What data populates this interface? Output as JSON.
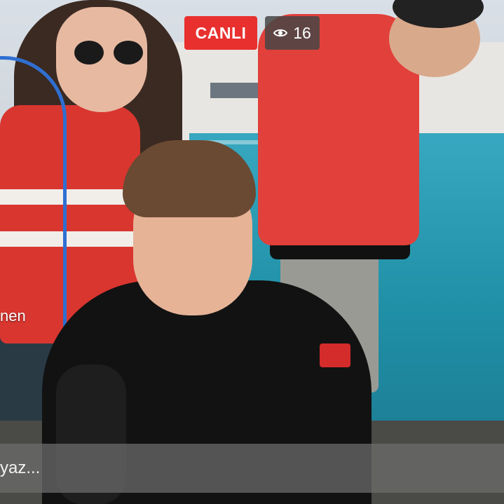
{
  "stream": {
    "live_label": "CANLI",
    "viewer_count": "16",
    "viewer_icon": "eye-icon",
    "live_color": "#e8302e"
  },
  "comment_feed": {
    "partial_username": "nen"
  },
  "comment_box": {
    "placeholder": "yaz..."
  }
}
